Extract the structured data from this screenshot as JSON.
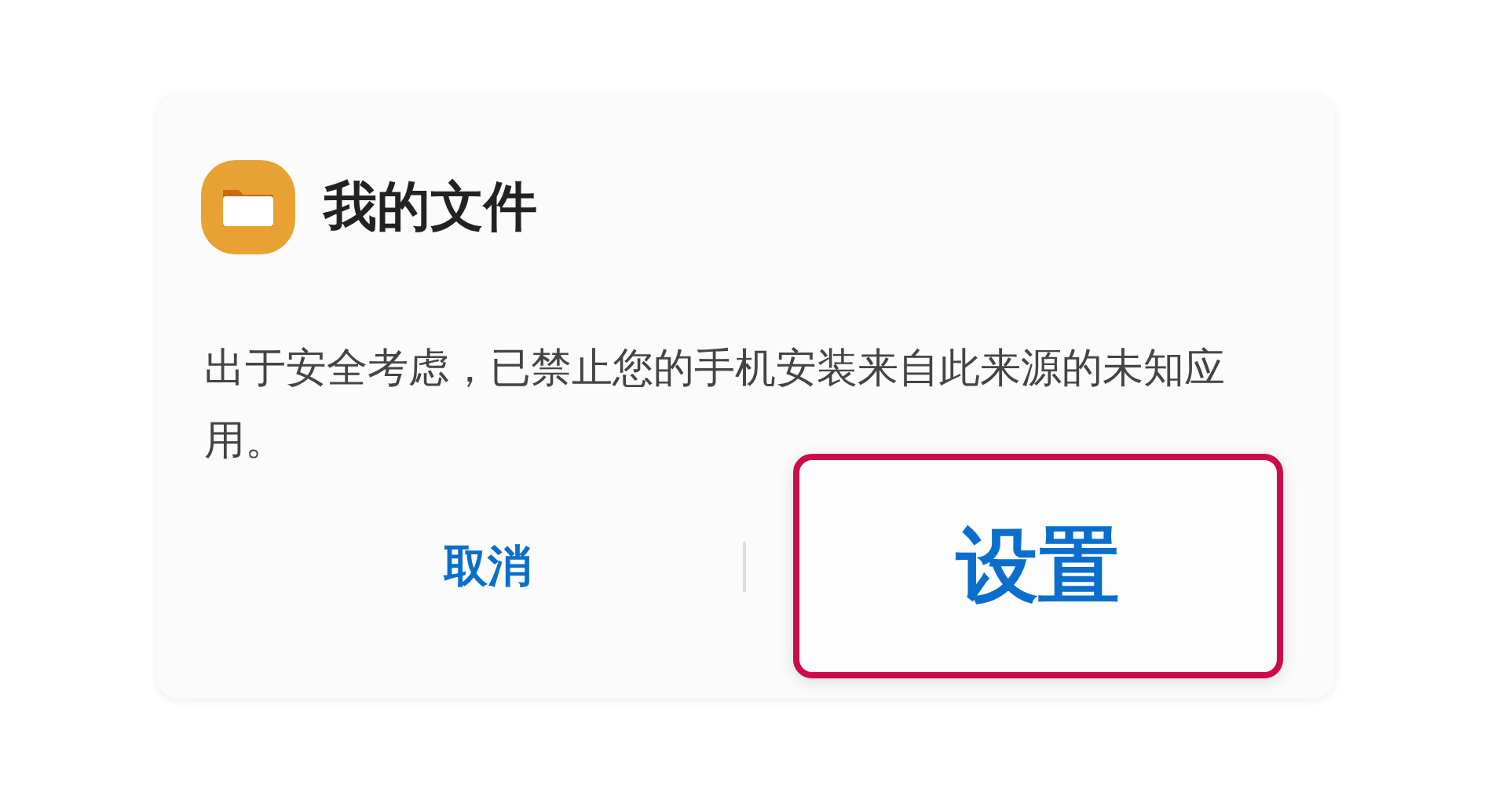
{
  "dialog": {
    "app_name": "我的文件",
    "message": "出于安全考虑，已禁止您的手机安装来自此来源的未知应用。",
    "buttons": [
      {
        "label": "取消",
        "highlighted": false
      },
      {
        "label": "设置",
        "highlighted": true
      }
    ]
  }
}
